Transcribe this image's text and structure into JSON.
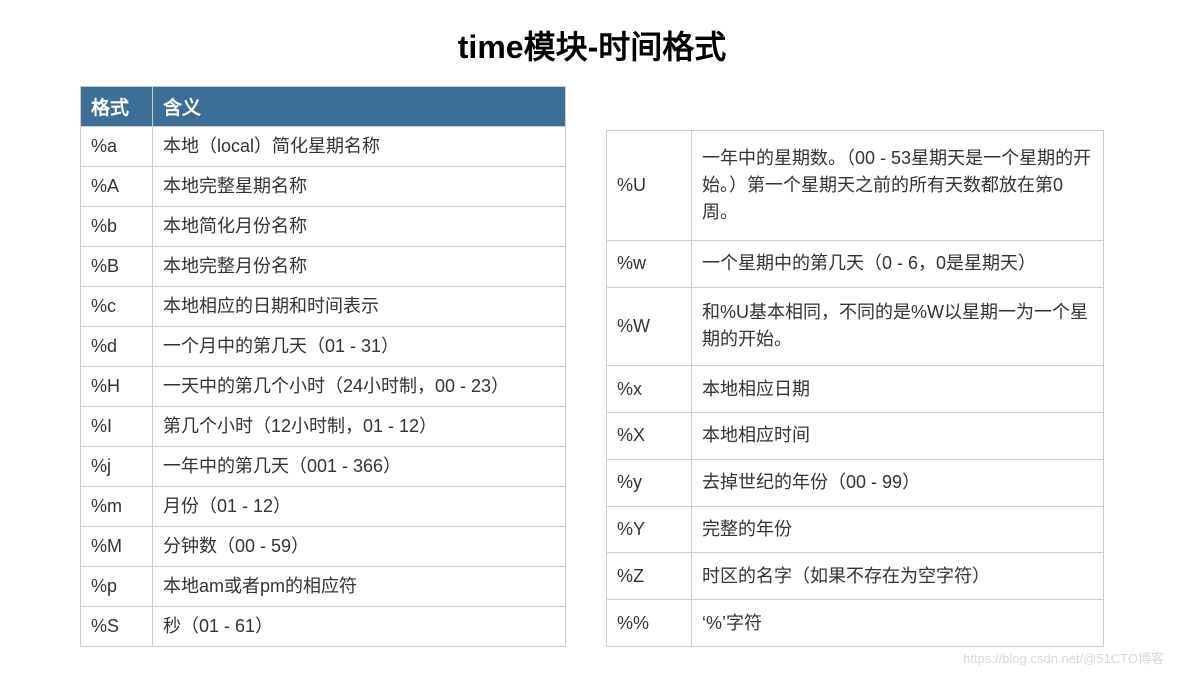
{
  "title": "time模块-时间格式",
  "left_header": {
    "col1": "格式",
    "col2": "含义"
  },
  "left": [
    {
      "code": "%a",
      "desc": "本地（local）简化星期名称"
    },
    {
      "code": "%A",
      "desc": "本地完整星期名称"
    },
    {
      "code": "%b",
      "desc": "本地简化月份名称"
    },
    {
      "code": "%B",
      "desc": "本地完整月份名称"
    },
    {
      "code": "%c",
      "desc": "本地相应的日期和时间表示"
    },
    {
      "code": "%d",
      "desc": "一个月中的第几天（01 - 31）"
    },
    {
      "code": "%H",
      "desc": "一天中的第几个小时（24小时制，00 - 23）"
    },
    {
      "code": "%I",
      "desc": "第几个小时（12小时制，01 - 12）"
    },
    {
      "code": "%j",
      "desc": "一年中的第几天（001 - 366）"
    },
    {
      "code": "%m",
      "desc": "月份（01 - 12）"
    },
    {
      "code": "%M",
      "desc": "分钟数（00 - 59）"
    },
    {
      "code": "%p",
      "desc": "本地am或者pm的相应符"
    },
    {
      "code": "%S",
      "desc": "秒（01 - 61）"
    }
  ],
  "right": [
    {
      "code": "%U",
      "desc": "一年中的星期数。（00 - 53星期天是一个星期的开始。）第一个星期天之前的所有天数都放在第0周。"
    },
    {
      "code": "%w",
      "desc": "一个星期中的第几天（0 - 6，0是星期天）"
    },
    {
      "code": "%W",
      "desc": "和%U基本相同，不同的是%W以星期一为一个星期的开始。"
    },
    {
      "code": "%x",
      "desc": "本地相应日期"
    },
    {
      "code": "%X",
      "desc": "本地相应时间"
    },
    {
      "code": "%y",
      "desc": "去掉世纪的年份（00 - 99）"
    },
    {
      "code": "%Y",
      "desc": "完整的年份"
    },
    {
      "code": "%Z",
      "desc": "时区的名字（如果不存在为空字符）"
    },
    {
      "code": "%%",
      "desc": "‘%’字符"
    }
  ],
  "watermark": "https://blog.csdn.net/@51CTO博客"
}
